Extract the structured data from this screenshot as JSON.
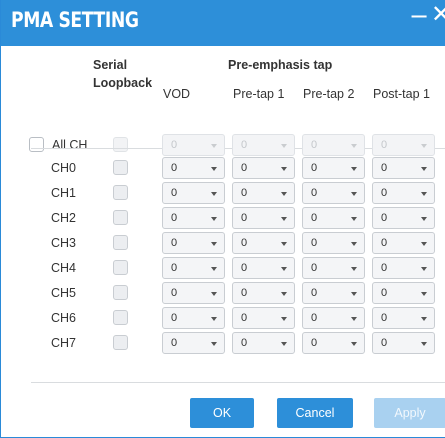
{
  "dialog": {
    "title": "PMA SETTING",
    "minimize_glyph": "−",
    "close_glyph": "✕"
  },
  "headers": {
    "serial": "Serial",
    "loopback": "Loopback",
    "preemphasis": "Pre-emphasis tap",
    "vod": "VOD",
    "pretap1": "Pre-tap 1",
    "pretap2": "Pre-tap 2",
    "posttap1": "Post-tap 1"
  },
  "all_channels": {
    "label": "All CH",
    "checked": false,
    "values": [
      "0",
      "0",
      "0",
      "0"
    ],
    "disabled": true
  },
  "channels": [
    {
      "label": "CH0",
      "values": [
        "0",
        "0",
        "0",
        "0"
      ]
    },
    {
      "label": "CH1",
      "values": [
        "0",
        "0",
        "0",
        "0"
      ]
    },
    {
      "label": "CH2",
      "values": [
        "0",
        "0",
        "0",
        "0"
      ]
    },
    {
      "label": "CH3",
      "values": [
        "0",
        "0",
        "0",
        "0"
      ]
    },
    {
      "label": "CH4",
      "values": [
        "0",
        "0",
        "0",
        "0"
      ]
    },
    {
      "label": "CH5",
      "values": [
        "0",
        "0",
        "0",
        "0"
      ]
    },
    {
      "label": "CH6",
      "values": [
        "0",
        "0",
        "0",
        "0"
      ]
    },
    {
      "label": "CH7",
      "values": [
        "0",
        "0",
        "0",
        "0"
      ]
    }
  ],
  "buttons": {
    "ok": "OK",
    "cancel": "Cancel",
    "apply": "Apply"
  },
  "colors": {
    "accent": "#2d8fd9",
    "apply_disabled": "#a9d1f0"
  },
  "icons": {
    "minimize": "minimize-icon",
    "close": "close-icon",
    "dropdown": "chevron-down-icon"
  }
}
